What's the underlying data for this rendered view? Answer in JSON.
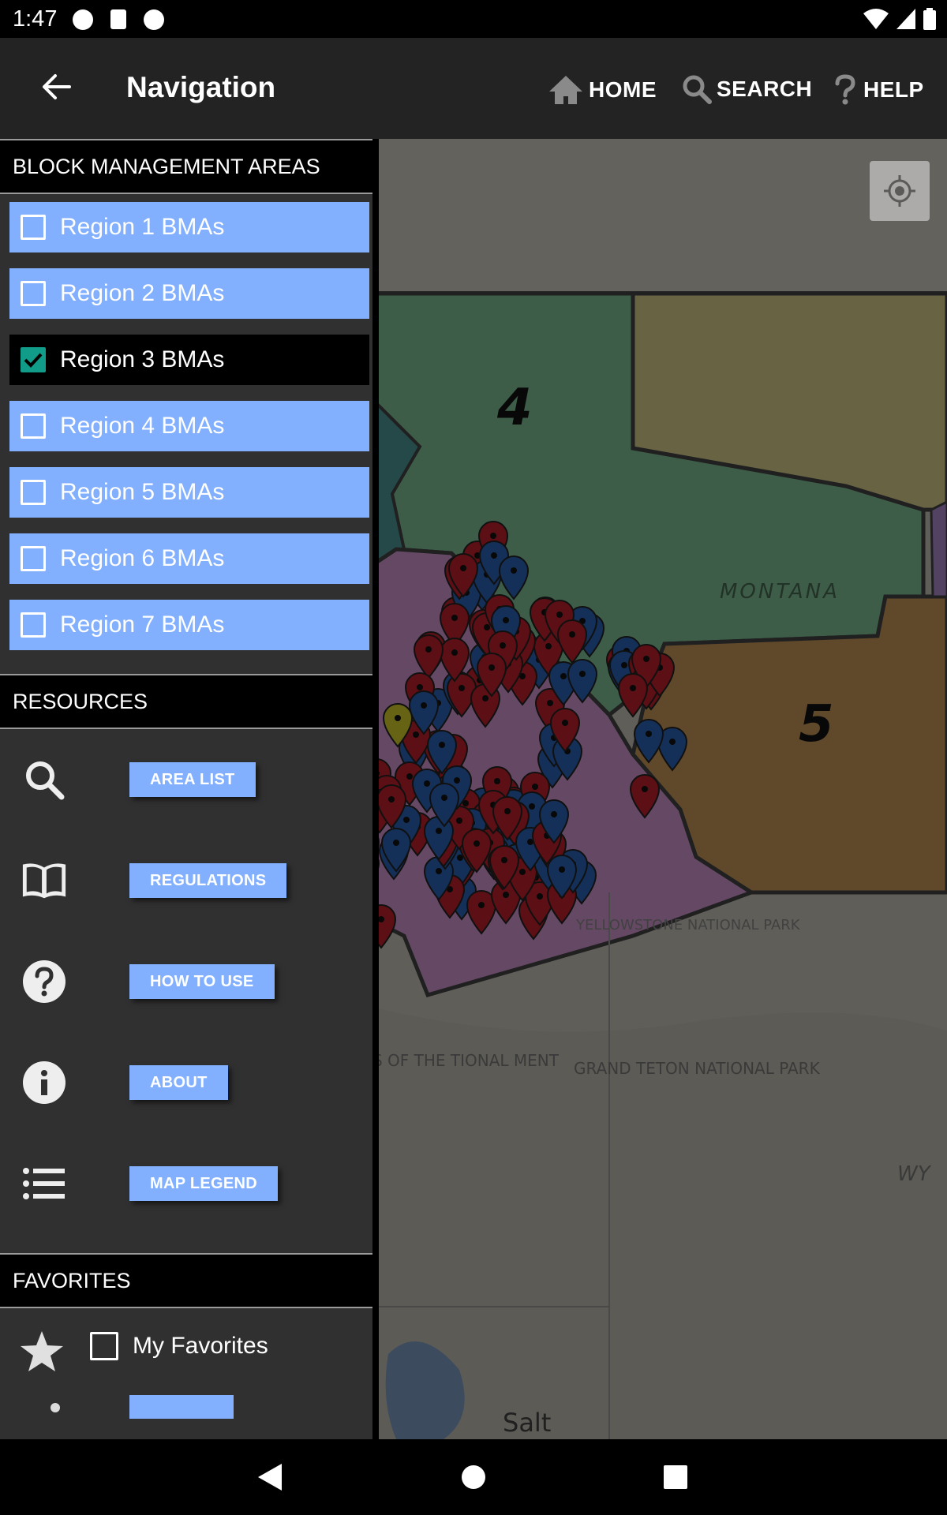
{
  "status_bar": {
    "time": "1:47"
  },
  "app_bar": {
    "title": "Navigation",
    "actions": [
      {
        "label": "HOME",
        "icon": "home-icon"
      },
      {
        "label": "SEARCH",
        "icon": "search-icon"
      },
      {
        "label": "HELP",
        "icon": "help-icon"
      }
    ]
  },
  "drawer": {
    "bma_section": {
      "title": "BLOCK MANAGEMENT AREAS",
      "regions": [
        {
          "label": "Region 1 BMAs",
          "checked": false
        },
        {
          "label": "Region 2 BMAs",
          "checked": false
        },
        {
          "label": "Region 3 BMAs",
          "checked": true
        },
        {
          "label": "Region 4 BMAs",
          "checked": false
        },
        {
          "label": "Region 5 BMAs",
          "checked": false
        },
        {
          "label": "Region 6 BMAs",
          "checked": false
        },
        {
          "label": "Region 7 BMAs",
          "checked": false
        }
      ]
    },
    "resources_section": {
      "title": "RESOURCES",
      "items": [
        {
          "label": "AREA LIST",
          "icon": "search-icon"
        },
        {
          "label": "REGULATIONS",
          "icon": "book-icon"
        },
        {
          "label": "HOW TO USE",
          "icon": "help-circle-icon"
        },
        {
          "label": "ABOUT",
          "icon": "info-icon"
        },
        {
          "label": "MAP LEGEND",
          "icon": "list-icon"
        }
      ]
    },
    "favorites_section": {
      "title": "FAVORITES",
      "my_favorites": {
        "label": "My Favorites",
        "checked": false
      }
    }
  },
  "map": {
    "labels": {
      "region_4": "4",
      "region_5": "5",
      "montana": "MONTANA",
      "yellowstone": "YELLOWSTONE NATIONAL PARK",
      "grand_teton": "GRAND TETON NATIONAL PARK",
      "monument": "S OF THE TIONAL MENT",
      "wyoming": "WY",
      "salt": "Salt"
    }
  },
  "colors": {
    "region_button": "#82b0ff",
    "checkbox_checked": "#109c88",
    "appbar": "#232323",
    "drawer": "#303030"
  }
}
